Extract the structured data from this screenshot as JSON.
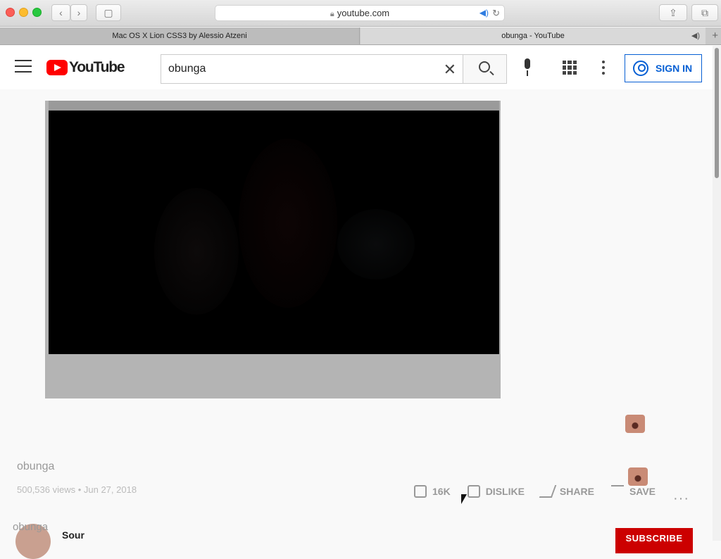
{
  "browser": {
    "address": "youtube.com",
    "tabs": [
      {
        "label": "Mac OS X Lion CSS3 by Alessio Atzeni"
      },
      {
        "label": "obunga - YouTube"
      }
    ]
  },
  "header": {
    "logo_text": "YouTube",
    "search": {
      "value": "obunga"
    },
    "signin_label": "SIGN IN"
  },
  "video": {
    "title": "obunga",
    "stats": "500,536 views • Jun 27, 2018",
    "actions": {
      "like_count": "16K",
      "dislike_label": "DISLIKE",
      "share_label": "SHARE",
      "save_label": "SAVE"
    }
  },
  "channel": {
    "ghost_name": "obunga",
    "name": "Sour",
    "subscribe_label": "SUBSCRIBE"
  },
  "colors": {
    "brand_red": "#ff0000",
    "link_blue": "#065fd4",
    "subscribe_red": "#cc0000"
  }
}
